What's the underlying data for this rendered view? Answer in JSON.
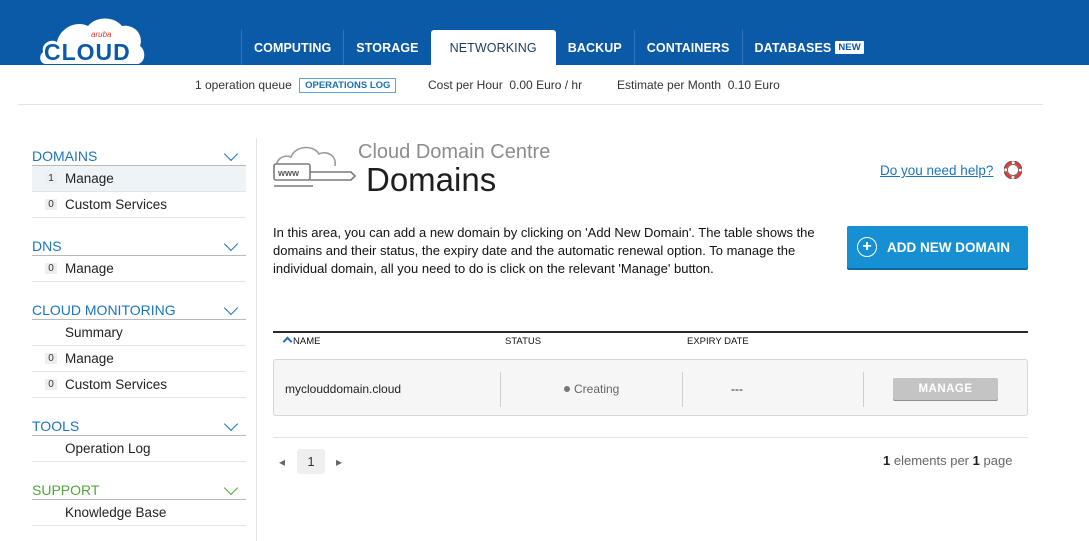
{
  "brand": {
    "logo_small": "aruba",
    "logo_big": "CLOUD"
  },
  "nav": {
    "items": [
      {
        "label": "COMPUTING"
      },
      {
        "label": "STORAGE"
      },
      {
        "label": "NETWORKING",
        "active": true
      },
      {
        "label": "BACKUP"
      },
      {
        "label": "CONTAINERS"
      },
      {
        "label": "DATABASES",
        "badge": "NEW"
      }
    ]
  },
  "ops": {
    "queue_text": "1 operation queue",
    "log_button": "OPERATIONS LOG",
    "cost_hour_label": "Cost per Hour",
    "cost_hour_value": "0.00 Euro / hr",
    "estimate_label": "Estimate per Month",
    "estimate_value": "0.10 Euro"
  },
  "sidebar": {
    "sections": [
      {
        "title": "DOMAINS",
        "items": [
          {
            "count": "1",
            "label": "Manage",
            "selected": true
          },
          {
            "count": "0",
            "label": "Custom Services"
          }
        ]
      },
      {
        "title": "DNS",
        "items": [
          {
            "count": "0",
            "label": "Manage"
          }
        ]
      },
      {
        "title": "CLOUD MONITORING",
        "items": [
          {
            "count": "",
            "label": "Summary"
          },
          {
            "count": "0",
            "label": "Manage"
          },
          {
            "count": "0",
            "label": "Custom Services"
          }
        ]
      },
      {
        "title": "TOOLS",
        "items": [
          {
            "count": "",
            "label": "Operation Log"
          }
        ]
      },
      {
        "title": "SUPPORT",
        "items": [
          {
            "count": "",
            "label": "Knowledge Base"
          }
        ]
      }
    ]
  },
  "main": {
    "icon_text": "www",
    "subtitle": "Cloud Domain Centre",
    "title": "Domains",
    "help_link": "Do you need help?",
    "description": "In this area, you can add a new domain by clicking on 'Add New Domain'. The table shows the domains and their status, the expiry date and the automatic renewal option. To manage the individual domain, all you need to do is click on the relevant 'Manage' button.",
    "add_button": "ADD NEW DOMAIN"
  },
  "table": {
    "headers": {
      "name": "NAME",
      "status": "STATUS",
      "expiry": "EXPIRY DATE"
    },
    "rows": [
      {
        "name": "myclouddomain.cloud",
        "status": "Creating",
        "expiry": "---",
        "action": "MANAGE"
      }
    ]
  },
  "pagination": {
    "current_page": "1",
    "per_page_count": "1",
    "per_page_text": "elements per",
    "pages_count": "1",
    "pages_text": "page"
  },
  "colors": {
    "header_blue": "#0b5aa8",
    "link_blue": "#1b74c0",
    "button_blue": "#168fd3",
    "support_green": "#4ea83b",
    "manage_grey": "#c4c4c4"
  }
}
